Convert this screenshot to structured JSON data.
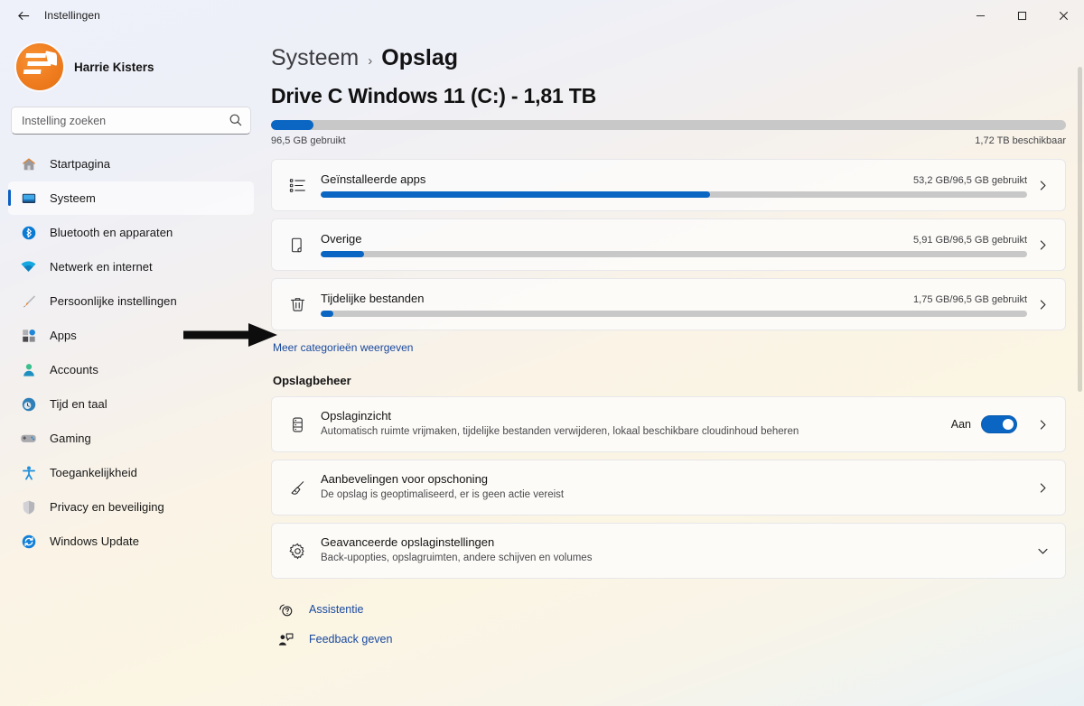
{
  "window": {
    "title": "Instellingen",
    "back_label": "back-arrow",
    "minimize": "–",
    "maximize": "□",
    "close": "×"
  },
  "sidebar": {
    "profile_name": "Harrie Kisters",
    "search": {
      "placeholder": "Instelling zoeken",
      "value": ""
    },
    "items": [
      {
        "label": "Startpagina",
        "icon": "home-icon",
        "active": false
      },
      {
        "label": "Systeem",
        "icon": "monitor-icon",
        "active": true
      },
      {
        "label": "Bluetooth en apparaten",
        "icon": "bluetooth-icon",
        "active": false
      },
      {
        "label": "Netwerk en internet",
        "icon": "wifi-icon",
        "active": false
      },
      {
        "label": "Persoonlijke instellingen",
        "icon": "paintbrush-icon",
        "active": false
      },
      {
        "label": "Apps",
        "icon": "apps-icon",
        "active": false
      },
      {
        "label": "Accounts",
        "icon": "person-icon",
        "active": false
      },
      {
        "label": "Tijd en taal",
        "icon": "clock-globe-icon",
        "active": false
      },
      {
        "label": "Gaming",
        "icon": "gamepad-icon",
        "active": false
      },
      {
        "label": "Toegankelijkheid",
        "icon": "accessibility-icon",
        "active": false
      },
      {
        "label": "Privacy en beveiliging",
        "icon": "shield-icon",
        "active": false
      },
      {
        "label": "Windows Update",
        "icon": "update-icon",
        "active": false
      }
    ]
  },
  "breadcrumb": {
    "parent": "Systeem",
    "separator": "›",
    "current": "Opslag"
  },
  "drive": {
    "title": "Drive C Windows 11 (C:) - 1,81 TB",
    "used_label": "96,5 GB gebruikt",
    "free_label": "1,72 TB beschikbaar",
    "used_percent": 5.3
  },
  "categories": [
    {
      "name": "Geïnstalleerde apps",
      "usage": "53,2 GB/96,5 GB gebruikt",
      "percent": 55.1,
      "icon": "list-bullets-icon",
      "chevron": "chevron-right-icon"
    },
    {
      "name": "Overige",
      "usage": "5,91 GB/96,5 GB gebruikt",
      "percent": 6.1,
      "icon": "folder-page-icon",
      "chevron": "chevron-right-icon"
    },
    {
      "name": "Tijdelijke bestanden",
      "usage": "1,75 GB/96,5 GB gebruikt",
      "percent": 1.8,
      "icon": "trash-icon",
      "chevron": "chevron-right-icon"
    }
  ],
  "more_categories_link": "Meer categorieën weergeven",
  "management": {
    "heading": "Opslagbeheer",
    "items": [
      {
        "title": "Opslaginzicht",
        "subtitle": "Automatisch ruimte vrijmaken, tijdelijke bestanden verwijderen, lokaal beschikbare cloudinhoud beheren",
        "icon": "storage-sense-icon",
        "toggle_label": "Aan",
        "toggle_on": true,
        "chevron": "chevron-right-icon"
      },
      {
        "title": "Aanbevelingen voor opschoning",
        "subtitle": "De opslag is geoptimaliseerd, er is geen actie vereist",
        "icon": "broom-icon",
        "toggle_label": null,
        "toggle_on": null,
        "chevron": "chevron-right-icon"
      },
      {
        "title": "Geavanceerde opslaginstellingen",
        "subtitle": "Back-upopties, opslagruimten, andere schijven en volumes",
        "icon": "gear-icon",
        "toggle_label": null,
        "toggle_on": null,
        "chevron": "chevron-down-icon"
      }
    ]
  },
  "footer": {
    "links": [
      {
        "label": "Assistentie",
        "icon": "help-icon"
      },
      {
        "label": "Feedback geven",
        "icon": "feedback-icon"
      }
    ]
  },
  "annotation": {
    "arrow": "right-pointing-annotation-arrow"
  },
  "colors": {
    "accent": "#0a66c2",
    "link": "#17489e",
    "track": "#c8c8c8"
  }
}
